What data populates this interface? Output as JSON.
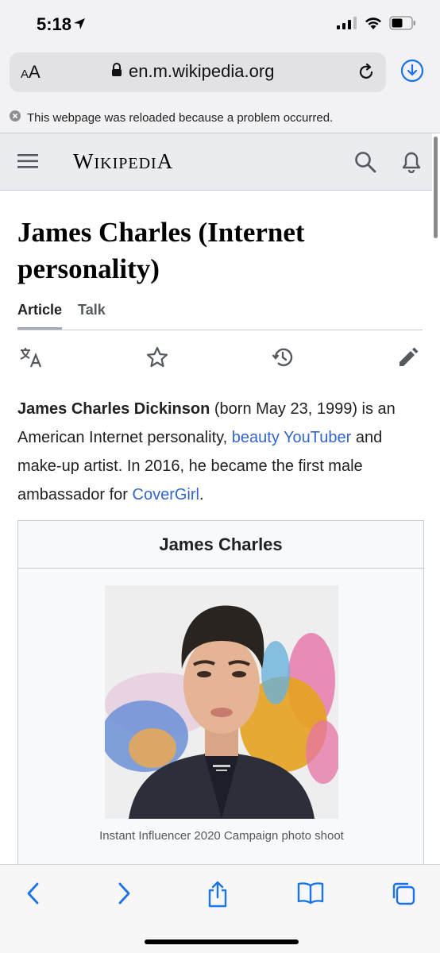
{
  "status_bar": {
    "time": "5:18"
  },
  "browser": {
    "aa_label_small": "A",
    "aa_label_large": "A",
    "url": "en.m.wikipedia.org",
    "notice": "This webpage was reloaded because a problem occurred."
  },
  "wiki_header": {
    "logo": "Wikipedia"
  },
  "article": {
    "title": "James Charles (Internet personality)",
    "tabs": [
      {
        "label": "Article",
        "active": true
      },
      {
        "label": "Talk",
        "active": false
      }
    ],
    "lead": {
      "bold_name": "James Charles Dickinson",
      "text_1": " (born May 23, 1999) is an American Internet personality, ",
      "link_1": "beauty YouTuber",
      "text_2": " and make-up artist. In 2016, he became the first male ambassador for ",
      "link_2": "CoverGirl",
      "text_3": "."
    },
    "infobox": {
      "title": "James Charles",
      "caption": "Instant Influencer 2020 Campaign photo shoot"
    }
  },
  "colors": {
    "link": "#3366cc",
    "accent": "#1a73e8",
    "header_bg": "#eaecf0"
  },
  "icons": [
    "location-arrow-icon",
    "cellular-signal-icon",
    "wifi-icon",
    "battery-icon",
    "lock-icon",
    "reload-icon",
    "download-icon",
    "close-circle-icon",
    "menu-icon",
    "search-icon",
    "bell-icon",
    "translate-icon",
    "star-icon",
    "history-icon",
    "edit-icon",
    "back-icon",
    "forward-icon",
    "share-icon",
    "bookmarks-icon",
    "tabs-icon"
  ]
}
